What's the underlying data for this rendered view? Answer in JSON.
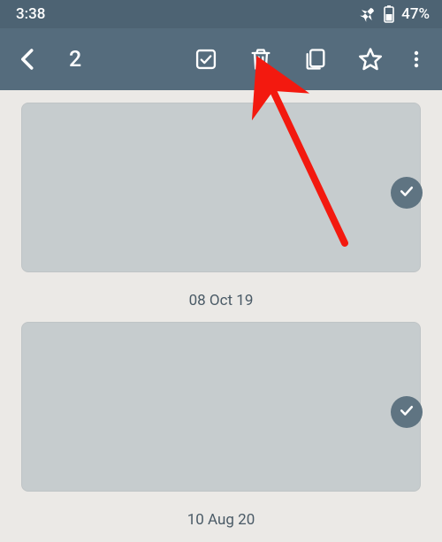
{
  "status_bar": {
    "time": "3:38",
    "battery_text": "47%"
  },
  "app_bar": {
    "selection_count": "2"
  },
  "items": [
    {
      "date_label": "08 Oct 19"
    },
    {
      "date_label": "10 Aug 20"
    }
  ],
  "annotation": {
    "arrow_color": "#f3190f"
  }
}
